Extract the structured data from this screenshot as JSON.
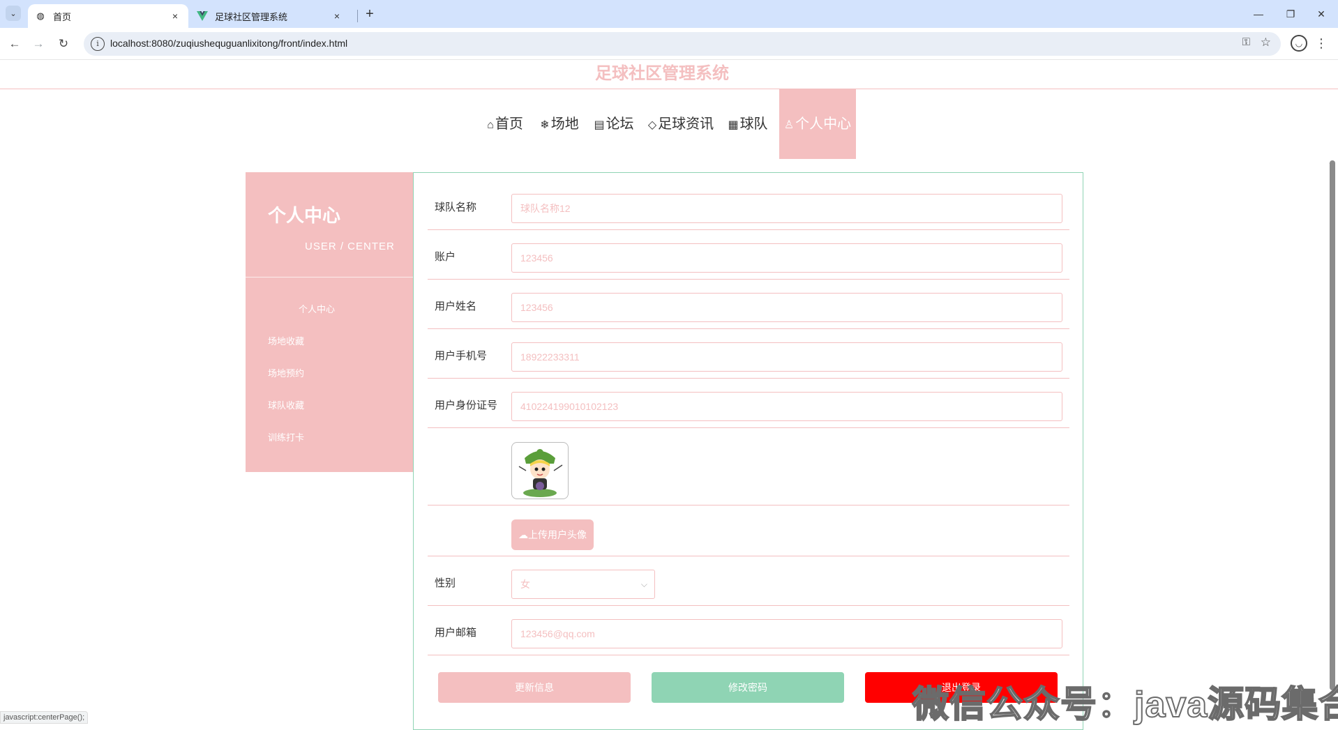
{
  "browser": {
    "tabs": [
      {
        "title": "首页",
        "icon": "globe-icon",
        "active": true
      },
      {
        "title": "足球社区管理系统",
        "icon": "vue-icon",
        "active": false
      }
    ],
    "tab_close": "×",
    "new_tab": "+",
    "url": "localhost:8080/zuqiushequguanlixitong/front/index.html",
    "back": "←",
    "forward": "→",
    "reload": "↻",
    "minimize": "—",
    "restore": "❐",
    "close": "✕",
    "menu": "⋮",
    "tab_list": "⌄",
    "key": "⚿",
    "star": "☆",
    "info": "i",
    "profile": "◡"
  },
  "site": {
    "title": "足球社区管理系统"
  },
  "nav": {
    "items": [
      {
        "icon": "⌂",
        "label": "首页"
      },
      {
        "icon": "❄",
        "label": "场地"
      },
      {
        "icon": "▤",
        "label": "论坛"
      },
      {
        "icon": "◇",
        "label": "足球资讯"
      },
      {
        "icon": "▦",
        "label": "球队"
      },
      {
        "icon": "♙",
        "label": "个人中心"
      }
    ],
    "active_index": 5
  },
  "sidebar": {
    "title": "个人中心",
    "subtitle": "USER / CENTER",
    "items": [
      "个人中心",
      "场地收藏",
      "场地预约",
      "球队收藏",
      "训练打卡"
    ]
  },
  "form": {
    "team_name": {
      "label": "球队名称",
      "value": "球队名称12"
    },
    "account": {
      "label": "账户",
      "value": "123456"
    },
    "user_name": {
      "label": "用户姓名",
      "value": "123456"
    },
    "phone": {
      "label": "用户手机号",
      "value": "18922233311"
    },
    "id_card": {
      "label": "用户身份证号",
      "value": "410224199010102123"
    },
    "upload_label": "上传用户头像",
    "upload_icon": "☁",
    "gender": {
      "label": "性别",
      "value": "女",
      "chevron": "⌵"
    },
    "email": {
      "label": "用户邮箱",
      "value": "123456@qq.com"
    }
  },
  "buttons": {
    "update": "更新信息",
    "change_password": "修改密码",
    "logout": "退出登录"
  },
  "colors": {
    "theme_pink": "#f4bfc0",
    "theme_green": "#8fd4b4",
    "logout_red": "#ff0000"
  },
  "status_bar": "javascript:centerPage();",
  "watermark": "微信公众号：java源码集合"
}
